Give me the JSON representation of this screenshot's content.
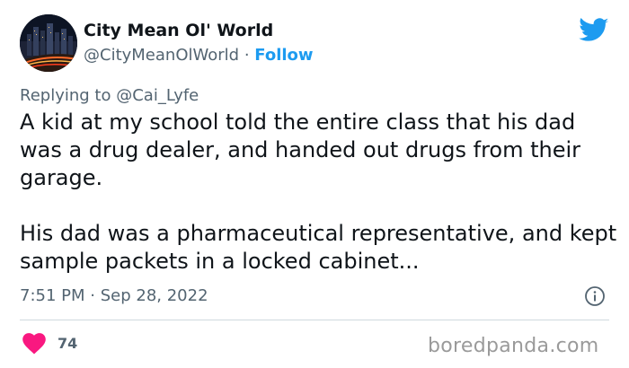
{
  "author": {
    "display_name": "City Mean Ol' World",
    "handle": "@CityMeanOlWorld",
    "separator": "·",
    "follow_label": "Follow"
  },
  "reply": {
    "prefix": "Replying to",
    "mention": "@Cai_Lyfe"
  },
  "tweet": {
    "paragraphs": [
      "A kid at my school told the entire class that his dad was a drug dealer, and handed out drugs from their garage.",
      "His dad was a pharmaceutical representative, and kept sample packets in a locked cabinet..."
    ],
    "time": "7:51 PM",
    "date_separator": "·",
    "date": "Sep 28, 2022"
  },
  "engagement": {
    "likes": "74"
  },
  "watermark": "boredpanda.com",
  "icons": {
    "platform": "twitter-bird-icon",
    "info": "info-icon",
    "like": "heart-icon"
  },
  "colors": {
    "accent": "#1d9bf0",
    "like": "#f91880",
    "secondary_text": "#536471",
    "primary_text": "#0f1419",
    "divider": "#cfd9de",
    "watermark": "#9a9a9a"
  }
}
